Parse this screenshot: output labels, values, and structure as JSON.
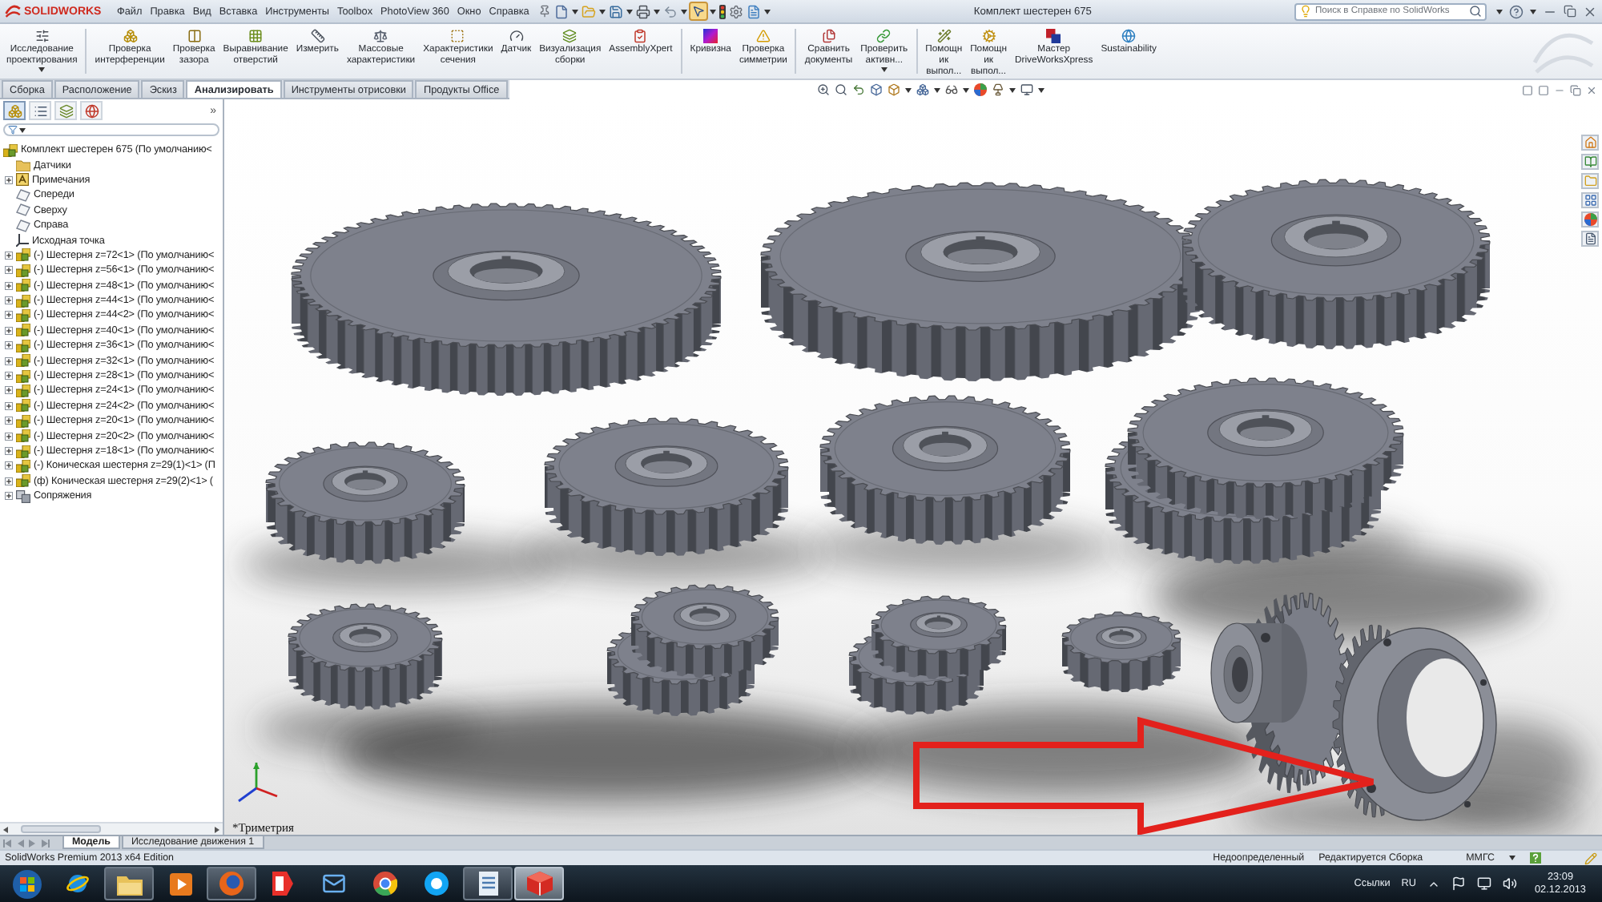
{
  "app": {
    "logo": "SOLIDWORKS",
    "menu": [
      "Файл",
      "Правка",
      "Вид",
      "Вставка",
      "Инструменты",
      "Toolbox",
      "PhotoView 360",
      "Окно",
      "Справка"
    ],
    "select_tool": {
      "on": true
    },
    "title": "Комплект шестерен 675",
    "search": {
      "placeholder": "Поиск в Справке по SolidWorks"
    }
  },
  "ribbon": {
    "groups": [
      {
        "buttons": [
          {
            "lines": [
              "Исследование",
              "проектирования"
            ],
            "has_menu": true
          }
        ]
      },
      {
        "buttons": [
          {
            "lines": [
              "Проверка",
              "интерференции"
            ],
            "has_menu": false
          },
          {
            "lines": [
              "Проверка",
              "зазора"
            ],
            "has_menu": false
          },
          {
            "lines": [
              "Выравнивание",
              "отверстий"
            ],
            "has_menu": false
          },
          {
            "lines": [
              "Измерить"
            ],
            "has_menu": false
          },
          {
            "lines": [
              "Массовые",
              "характеристики"
            ],
            "has_menu": false
          },
          {
            "lines": [
              "Характеристики",
              "сечения"
            ],
            "has_menu": false
          },
          {
            "lines": [
              "Датчик"
            ],
            "has_menu": false
          },
          {
            "lines": [
              "Визуализация",
              "сборки"
            ],
            "has_menu": false
          },
          {
            "lines": [
              "AssemblyXpert"
            ],
            "has_menu": false
          }
        ]
      },
      {
        "buttons": [
          {
            "lines": [
              "Кривизна"
            ],
            "has_menu": false
          },
          {
            "lines": [
              "Проверка",
              "симметрии"
            ],
            "has_menu": false
          }
        ]
      },
      {
        "buttons": [
          {
            "lines": [
              "Сравнить",
              "документы"
            ],
            "has_menu": false
          },
          {
            "lines": [
              "Проверить",
              "активн..."
            ],
            "has_menu": true
          }
        ]
      },
      {
        "buttons": [
          {
            "lines": [
              "Помощн",
              "ик",
              "выпол..."
            ],
            "has_menu": false
          },
          {
            "lines": [
              "Помощн",
              "ик",
              "выпол..."
            ],
            "has_menu": false
          },
          {
            "lines": [
              "Мастер",
              "DriveWorksXpress"
            ],
            "has_menu": false
          },
          {
            "lines": [
              "Sustainability"
            ],
            "has_menu": false
          }
        ]
      }
    ]
  },
  "tabs": [
    {
      "label": "Сборка",
      "selected": false
    },
    {
      "label": "Расположение",
      "selected": false
    },
    {
      "label": "Эскиз",
      "selected": false
    },
    {
      "label": "Анализировать",
      "selected": true
    },
    {
      "label": "Инструменты отрисовки",
      "selected": false
    },
    {
      "label": "Продукты Office",
      "selected": false
    }
  ],
  "feature_tree": {
    "panel_tabs": [
      {
        "selected": true
      },
      {
        "selected": false
      },
      {
        "selected": false
      },
      {
        "selected": false
      }
    ],
    "overflow": "»",
    "items": [
      {
        "kind": "assembly",
        "label": "Комплект шестерен 675 (По умолчанию<",
        "children": [
          {
            "kind": "folder",
            "label": "Датчики"
          },
          {
            "kind": "annotations",
            "label": "Примечания",
            "expanded": false
          },
          {
            "kind": "plane",
            "label": "Спереди"
          },
          {
            "kind": "plane",
            "label": "Сверху"
          },
          {
            "kind": "plane",
            "label": "Справа"
          },
          {
            "kind": "origin",
            "label": "Исходная точка"
          },
          {
            "kind": "component",
            "label": "(-) Шестерня z=72<1> (По умолчанию<",
            "expanded": false
          },
          {
            "kind": "component",
            "label": "(-) Шестерня z=56<1> (По умолчанию<",
            "expanded": false
          },
          {
            "kind": "component",
            "label": "(-) Шестерня z=48<1> (По умолчанию<",
            "expanded": false
          },
          {
            "kind": "component",
            "label": "(-) Шестерня z=44<1> (По умолчанию<",
            "expanded": false
          },
          {
            "kind": "component",
            "label": "(-) Шестерня z=44<2> (По умолчанию<",
            "expanded": false
          },
          {
            "kind": "component",
            "label": "(-) Шестерня z=40<1> (По умолчанию<",
            "expanded": false
          },
          {
            "kind": "component",
            "label": "(-) Шестерня z=36<1> (По умолчанию<",
            "expanded": false
          },
          {
            "kind": "component",
            "label": "(-) Шестерня z=32<1> (По умолчанию<",
            "expanded": false
          },
          {
            "kind": "component",
            "label": "(-) Шестерня z=28<1> (По умолчанию<",
            "expanded": false
          },
          {
            "kind": "component",
            "label": "(-) Шестерня z=24<1> (По умолчанию<",
            "expanded": false
          },
          {
            "kind": "component",
            "label": "(-) Шестерня z=24<2> (По умолчанию<",
            "expanded": false
          },
          {
            "kind": "component",
            "label": "(-) Шестерня z=20<1> (По умолчанию<",
            "expanded": false
          },
          {
            "kind": "component",
            "label": "(-) Шестерня z=20<2> (По умолчанию<",
            "expanded": false
          },
          {
            "kind": "component",
            "label": "(-) Шестерня z=18<1> (По умолчанию<",
            "expanded": false
          },
          {
            "kind": "component",
            "label": "(-) Коническая шестерня z=29(1)<1> (П",
            "expanded": false
          },
          {
            "kind": "component",
            "label": "(ф) Коническая шестерня z=29(2)<1> (",
            "expanded": false
          },
          {
            "kind": "mates",
            "label": "Сопряжения",
            "expanded": false
          }
        ]
      }
    ]
  },
  "viewport": {
    "view_label": "*Триметрия"
  },
  "bottom_tabs": [
    {
      "label": "Модель",
      "selected": true
    },
    {
      "label": "Исследование движения 1",
      "selected": false
    }
  ],
  "status_bar": {
    "product": "SolidWorks Premium 2013 x64 Edition",
    "fields": [
      "Недоопределенный",
      "Редактируется Сборка",
      "ММГС"
    ]
  },
  "taskbar": {
    "apps": [
      {
        "running": false,
        "selected": false
      },
      {
        "running": true,
        "selected": false
      },
      {
        "running": false,
        "selected": false
      },
      {
        "running": true,
        "selected": false
      },
      {
        "running": false,
        "selected": false
      },
      {
        "running": false,
        "selected": false
      },
      {
        "running": false,
        "selected": false
      },
      {
        "running": false,
        "selected": false
      },
      {
        "running": true,
        "selected": false
      },
      {
        "running": true,
        "selected": true
      }
    ],
    "links": "Ссылки",
    "language": "RU",
    "time": "23:09",
    "date": "02.12.2013"
  }
}
